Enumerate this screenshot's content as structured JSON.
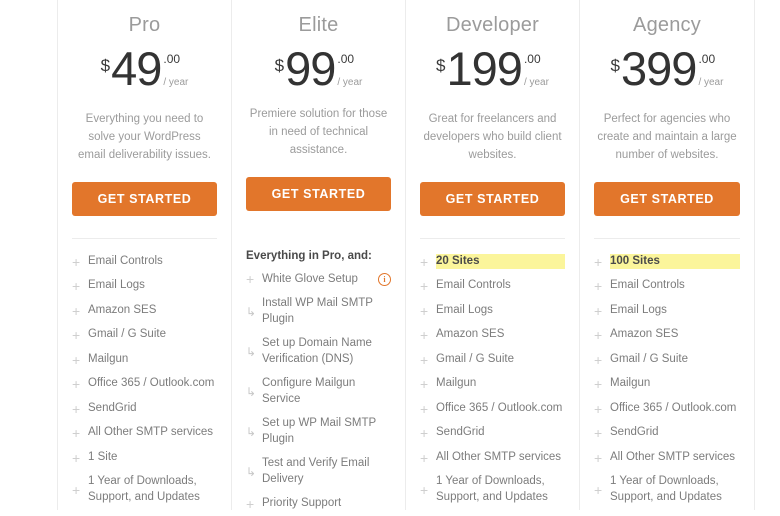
{
  "colors": {
    "cta_background": "#e2762b",
    "highlight_background": "#fbf59b",
    "divider": "#ececec",
    "plan_name": "#9b9b9b",
    "price": "#333333",
    "feature_text": "#7c7c7c",
    "info_icon": "#e2762b"
  },
  "plans": [
    {
      "name": "Pro",
      "currency": "$",
      "amount": "49",
      "cents": ".00",
      "period": "/ year",
      "tagline": "Everything you need to solve your WordPress email deliverability issues.",
      "cta_label": "GET STARTED",
      "group_heading": "",
      "features": [
        {
          "label": "Email Controls",
          "bullet": "+",
          "sub": false,
          "highlight": false,
          "info": false
        },
        {
          "label": "Email Logs",
          "bullet": "+",
          "sub": false,
          "highlight": false,
          "info": false
        },
        {
          "label": "Amazon SES",
          "bullet": "+",
          "sub": false,
          "highlight": false,
          "info": false
        },
        {
          "label": "Gmail / G Suite",
          "bullet": "+",
          "sub": false,
          "highlight": false,
          "info": false
        },
        {
          "label": "Mailgun",
          "bullet": "+",
          "sub": false,
          "highlight": false,
          "info": false
        },
        {
          "label": "Office 365 / Outlook.com",
          "bullet": "+",
          "sub": false,
          "highlight": false,
          "info": false
        },
        {
          "label": "SendGrid",
          "bullet": "+",
          "sub": false,
          "highlight": false,
          "info": false
        },
        {
          "label": "All Other SMTP services",
          "bullet": "+",
          "sub": false,
          "highlight": false,
          "info": false
        },
        {
          "label": "1 Site",
          "bullet": "+",
          "sub": false,
          "highlight": false,
          "info": false
        },
        {
          "label": "1 Year of Downloads, Support, and Updates",
          "bullet": "+",
          "sub": false,
          "highlight": false,
          "info": false
        }
      ]
    },
    {
      "name": "Elite",
      "currency": "$",
      "amount": "99",
      "cents": ".00",
      "period": "/ year",
      "tagline": "Premiere solution for those in need of technical assistance.",
      "cta_label": "GET STARTED",
      "group_heading": "Everything in Pro, and:",
      "features": [
        {
          "label": "White Glove Setup",
          "bullet": "+",
          "sub": false,
          "highlight": false,
          "info": true
        },
        {
          "label": "Install WP Mail SMTP Plugin",
          "bullet": "↳",
          "sub": true,
          "highlight": false,
          "info": false
        },
        {
          "label": "Set up Domain Name Verification (DNS)",
          "bullet": "↳",
          "sub": true,
          "highlight": false,
          "info": false
        },
        {
          "label": "Configure Mailgun Service",
          "bullet": "↳",
          "sub": true,
          "highlight": false,
          "info": false
        },
        {
          "label": "Set up WP Mail SMTP Plugin",
          "bullet": "↳",
          "sub": true,
          "highlight": false,
          "info": false
        },
        {
          "label": "Test and Verify Email Delivery",
          "bullet": "↳",
          "sub": true,
          "highlight": false,
          "info": false
        },
        {
          "label": "Priority Support",
          "bullet": "+",
          "sub": false,
          "highlight": false,
          "info": false
        }
      ]
    },
    {
      "name": "Developer",
      "currency": "$",
      "amount": "199",
      "cents": ".00",
      "period": "/ year",
      "tagline": "Great for freelancers and developers who build client websites.",
      "cta_label": "GET STARTED",
      "group_heading": "",
      "features": [
        {
          "label": "20 Sites",
          "bullet": "+",
          "sub": false,
          "highlight": true,
          "info": false
        },
        {
          "label": "Email Controls",
          "bullet": "+",
          "sub": false,
          "highlight": false,
          "info": false
        },
        {
          "label": "Email Logs",
          "bullet": "+",
          "sub": false,
          "highlight": false,
          "info": false
        },
        {
          "label": "Amazon SES",
          "bullet": "+",
          "sub": false,
          "highlight": false,
          "info": false
        },
        {
          "label": "Gmail / G Suite",
          "bullet": "+",
          "sub": false,
          "highlight": false,
          "info": false
        },
        {
          "label": "Mailgun",
          "bullet": "+",
          "sub": false,
          "highlight": false,
          "info": false
        },
        {
          "label": "Office 365 / Outlook.com",
          "bullet": "+",
          "sub": false,
          "highlight": false,
          "info": false
        },
        {
          "label": "SendGrid",
          "bullet": "+",
          "sub": false,
          "highlight": false,
          "info": false
        },
        {
          "label": "All Other SMTP services",
          "bullet": "+",
          "sub": false,
          "highlight": false,
          "info": false
        },
        {
          "label": "1 Year of Downloads, Support, and Updates",
          "bullet": "+",
          "sub": false,
          "highlight": false,
          "info": false
        }
      ]
    },
    {
      "name": "Agency",
      "currency": "$",
      "amount": "399",
      "cents": ".00",
      "period": "/ year",
      "tagline": "Perfect for agencies who create and maintain a large number of websites.",
      "cta_label": "GET STARTED",
      "group_heading": "",
      "features": [
        {
          "label": "100 Sites",
          "bullet": "+",
          "sub": false,
          "highlight": true,
          "info": false
        },
        {
          "label": "Email Controls",
          "bullet": "+",
          "sub": false,
          "highlight": false,
          "info": false
        },
        {
          "label": "Email Logs",
          "bullet": "+",
          "sub": false,
          "highlight": false,
          "info": false
        },
        {
          "label": "Amazon SES",
          "bullet": "+",
          "sub": false,
          "highlight": false,
          "info": false
        },
        {
          "label": "Gmail / G Suite",
          "bullet": "+",
          "sub": false,
          "highlight": false,
          "info": false
        },
        {
          "label": "Mailgun",
          "bullet": "+",
          "sub": false,
          "highlight": false,
          "info": false
        },
        {
          "label": "Office 365 / Outlook.com",
          "bullet": "+",
          "sub": false,
          "highlight": false,
          "info": false
        },
        {
          "label": "SendGrid",
          "bullet": "+",
          "sub": false,
          "highlight": false,
          "info": false
        },
        {
          "label": "All Other SMTP services",
          "bullet": "+",
          "sub": false,
          "highlight": false,
          "info": false
        },
        {
          "label": "1 Year of Downloads, Support, and Updates",
          "bullet": "+",
          "sub": false,
          "highlight": false,
          "info": false
        }
      ]
    }
  ],
  "icons": {
    "info": "i",
    "plus_bullet": "+",
    "sub_bullet": "↳"
  }
}
